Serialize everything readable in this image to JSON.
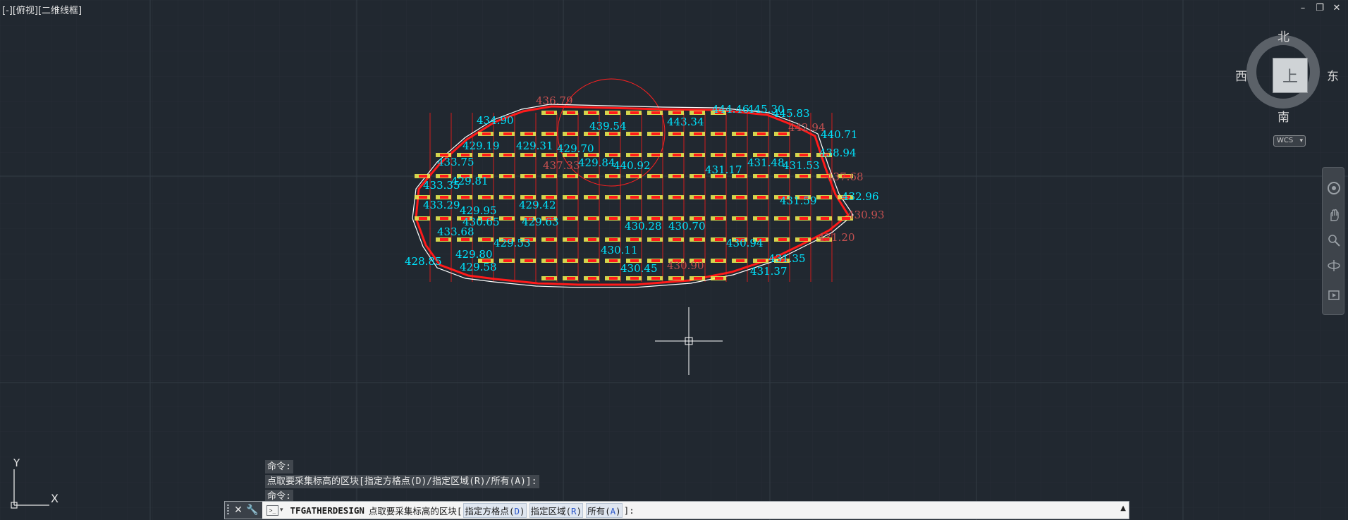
{
  "viewport": {
    "view_label": "[-][俯视][二维线框]",
    "window_controls": {
      "minimize": "–",
      "restore": "❐",
      "close": "✕"
    },
    "background_color": "#212830",
    "point_label_color": "#00e5ff",
    "boundary_color": "#ff1a1a",
    "marker_color": "#f2f252",
    "elevation_labels_cyan": [
      {
        "text": "436.79"
      },
      {
        "text": "434.90"
      },
      {
        "text": "439.54"
      },
      {
        "text": "443.34"
      },
      {
        "text": "444.46"
      },
      {
        "text": "445.30"
      },
      {
        "text": "445.83"
      },
      {
        "text": "442.94"
      },
      {
        "text": "440.71"
      },
      {
        "text": "429.19"
      },
      {
        "text": "429.31"
      },
      {
        "text": "429.70"
      },
      {
        "text": "429.81"
      },
      {
        "text": "433.75"
      },
      {
        "text": "437.33"
      },
      {
        "text": "429.84"
      },
      {
        "text": "440.92"
      },
      {
        "text": "431.17"
      },
      {
        "text": "431.48"
      },
      {
        "text": "431.53"
      },
      {
        "text": "438.94"
      },
      {
        "text": "437.68"
      },
      {
        "text": "433.35"
      },
      {
        "text": "432.96"
      },
      {
        "text": "433.29"
      },
      {
        "text": "429.95"
      },
      {
        "text": "429.42"
      },
      {
        "text": "431.59"
      },
      {
        "text": "430.93"
      },
      {
        "text": "430.65"
      },
      {
        "text": "429.63"
      },
      {
        "text": "430.28"
      },
      {
        "text": "430.70"
      },
      {
        "text": "433.68"
      },
      {
        "text": "429.53"
      },
      {
        "text": "431.20"
      },
      {
        "text": "430.94"
      },
      {
        "text": "429.80"
      },
      {
        "text": "430.11"
      },
      {
        "text": "431.35"
      },
      {
        "text": "429.58"
      },
      {
        "text": "430.45"
      },
      {
        "text": "430.90"
      },
      {
        "text": "431.37"
      },
      {
        "text": "428.85"
      }
    ]
  },
  "viewcube": {
    "north": "北",
    "south": "南",
    "west": "西",
    "east": "东",
    "face": "上",
    "wcs": "WCS"
  },
  "navbar": {
    "icons": [
      "steering-wheel-icon",
      "pan-icon",
      "zoom-extents-icon",
      "orbit-icon",
      "showmotion-icon"
    ]
  },
  "command_history": [
    "命令:",
    "点取要采集标高的区块[指定方格点(D)/指定区域(R)/所有(A)]:",
    "命令:"
  ],
  "command_line": {
    "prompt_icon": ">_",
    "command_name": "TFGATHERDESIGN",
    "prompt_text": "点取要采集标高的区块[",
    "option_1_label": "指定方格点(",
    "option_1_key": "D",
    "option_2_label": "指定区域(",
    "option_2_key": "R",
    "option_3_label": "所有(",
    "option_3_key": "A",
    "suffix": "]:"
  },
  "ucs_icon": {
    "x_label": "X",
    "y_label": "Y"
  }
}
